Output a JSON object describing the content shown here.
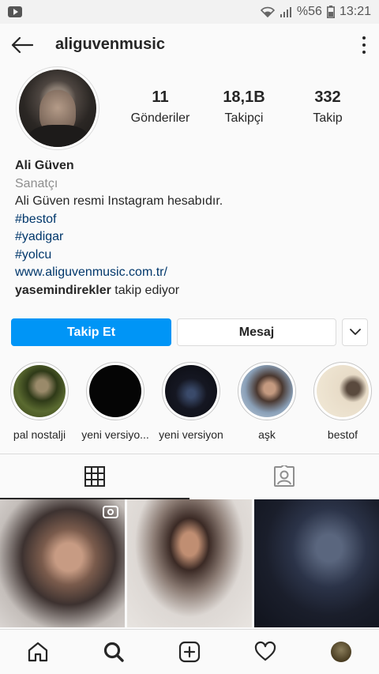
{
  "status_bar": {
    "battery": "%56",
    "time": "13:21"
  },
  "header": {
    "username": "aliguvenmusic"
  },
  "stats": [
    {
      "value": "11",
      "label": "Gönderiler"
    },
    {
      "value": "18,1B",
      "label": "Takipçi"
    },
    {
      "value": "332",
      "label": "Takip"
    }
  ],
  "bio": {
    "name": "Ali Güven",
    "category": "Sanatçı",
    "description": "Ali Güven resmi Instagram hesabıdır.",
    "tags": [
      "#bestof",
      "#yadigar",
      "#yolcu"
    ],
    "website": "www.aliguvenmusic.com.tr/",
    "followed_by_user": "yasemindirekler",
    "followed_by_suffix": " takip ediyor"
  },
  "buttons": {
    "follow": "Takip Et",
    "message": "Mesaj"
  },
  "highlights": [
    {
      "label": "pal nostalji"
    },
    {
      "label": "yeni versiyo..."
    },
    {
      "label": "yeni versiyon"
    },
    {
      "label": "aşk"
    },
    {
      "label": "bestof"
    }
  ],
  "tabs": [
    "grid-icon",
    "tagged-icon"
  ],
  "nav": [
    "home-icon",
    "search-icon",
    "add-icon",
    "heart-icon",
    "profile-avatar"
  ],
  "colors": {
    "accent": "#0095f6",
    "link": "#00376b",
    "secondary_text": "#8e8e8e"
  }
}
